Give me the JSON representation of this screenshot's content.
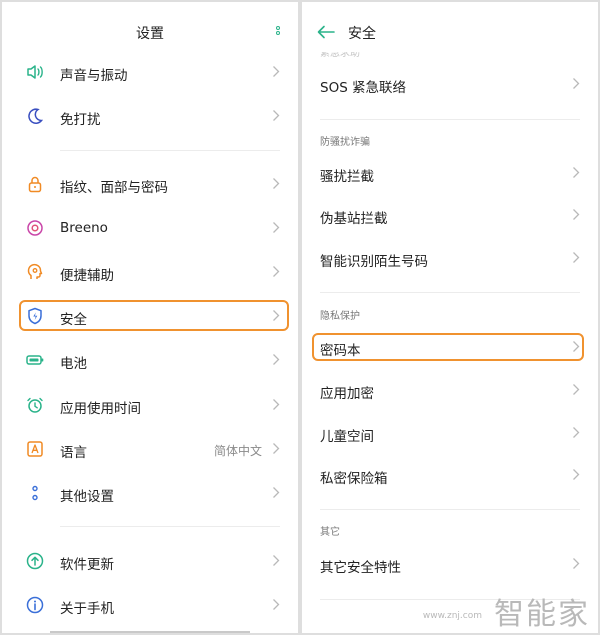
{
  "left": {
    "title": "设置",
    "items": [
      {
        "label": "声音与振动",
        "icon": "speaker-icon"
      },
      {
        "label": "免打扰",
        "icon": "moon-icon"
      },
      {
        "label": "指纹、面部与密码",
        "icon": "lock-icon"
      },
      {
        "label": "Breeno",
        "icon": "breeno-icon"
      },
      {
        "label": "便捷辅助",
        "icon": "assist-icon"
      },
      {
        "label": "安全",
        "icon": "shield-icon"
      },
      {
        "label": "电池",
        "icon": "battery-icon"
      },
      {
        "label": "应用使用时间",
        "icon": "app-timer-icon"
      },
      {
        "label": "语言",
        "value": "简体中文",
        "icon": "language-icon"
      },
      {
        "label": "其他设置",
        "icon": "other-settings-icon"
      },
      {
        "label": "软件更新",
        "icon": "update-icon"
      },
      {
        "label": "关于手机",
        "icon": "info-icon"
      }
    ]
  },
  "right": {
    "title": "安全",
    "top_section_partial": "紧急求助",
    "sections": [
      {
        "header": "防骚扰诈骗"
      },
      {
        "header": "隐私保护"
      },
      {
        "header": "其它"
      }
    ],
    "items": [
      {
        "label": "SOS 紧急联络"
      },
      {
        "label": "骚扰拦截"
      },
      {
        "label": "伪基站拦截"
      },
      {
        "label": "智能识别陌生号码"
      },
      {
        "label": "密码本"
      },
      {
        "label": "应用加密"
      },
      {
        "label": "儿童空间"
      },
      {
        "label": "私密保险箱"
      },
      {
        "label": "其它安全特性"
      }
    ]
  },
  "watermark": {
    "url": "www.znj.com",
    "name": "智能家"
  },
  "colors": {
    "accent": "#2ab38a",
    "highlight": "#f0922f",
    "icon_blue": "#3a6fd8",
    "icon_orange": "#f08a24",
    "icon_pink": "#e0527a"
  }
}
